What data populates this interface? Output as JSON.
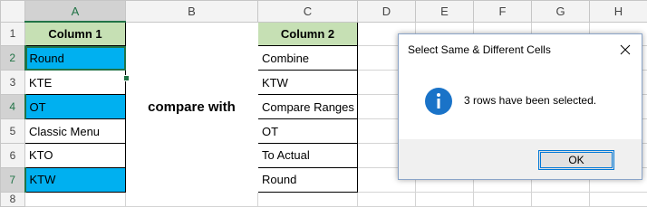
{
  "columns": [
    "",
    "A",
    "B",
    "C",
    "D",
    "E",
    "F",
    "G",
    "H"
  ],
  "rows": [
    "1",
    "2",
    "3",
    "4",
    "5",
    "6",
    "7",
    "8"
  ],
  "column1": {
    "header": "Column 1",
    "cells": [
      "Round",
      "KTE",
      "OT",
      "Classic Menu",
      "KTO",
      "KTW"
    ]
  },
  "compare_text": "compare with",
  "column2": {
    "header": "Column 2",
    "cells": [
      "Combine",
      "KTW",
      "Compare Ranges",
      "OT",
      "To Actual",
      "Round"
    ]
  },
  "dialog": {
    "title": "Select Same & Different Cells",
    "message": "3 rows have been selected.",
    "ok_label": "OK"
  },
  "colors": {
    "header_fill": "#c6e0b4",
    "selected_fill": "#00b0f0",
    "excel_green": "#217346",
    "info_icon": "#1a73c8"
  }
}
